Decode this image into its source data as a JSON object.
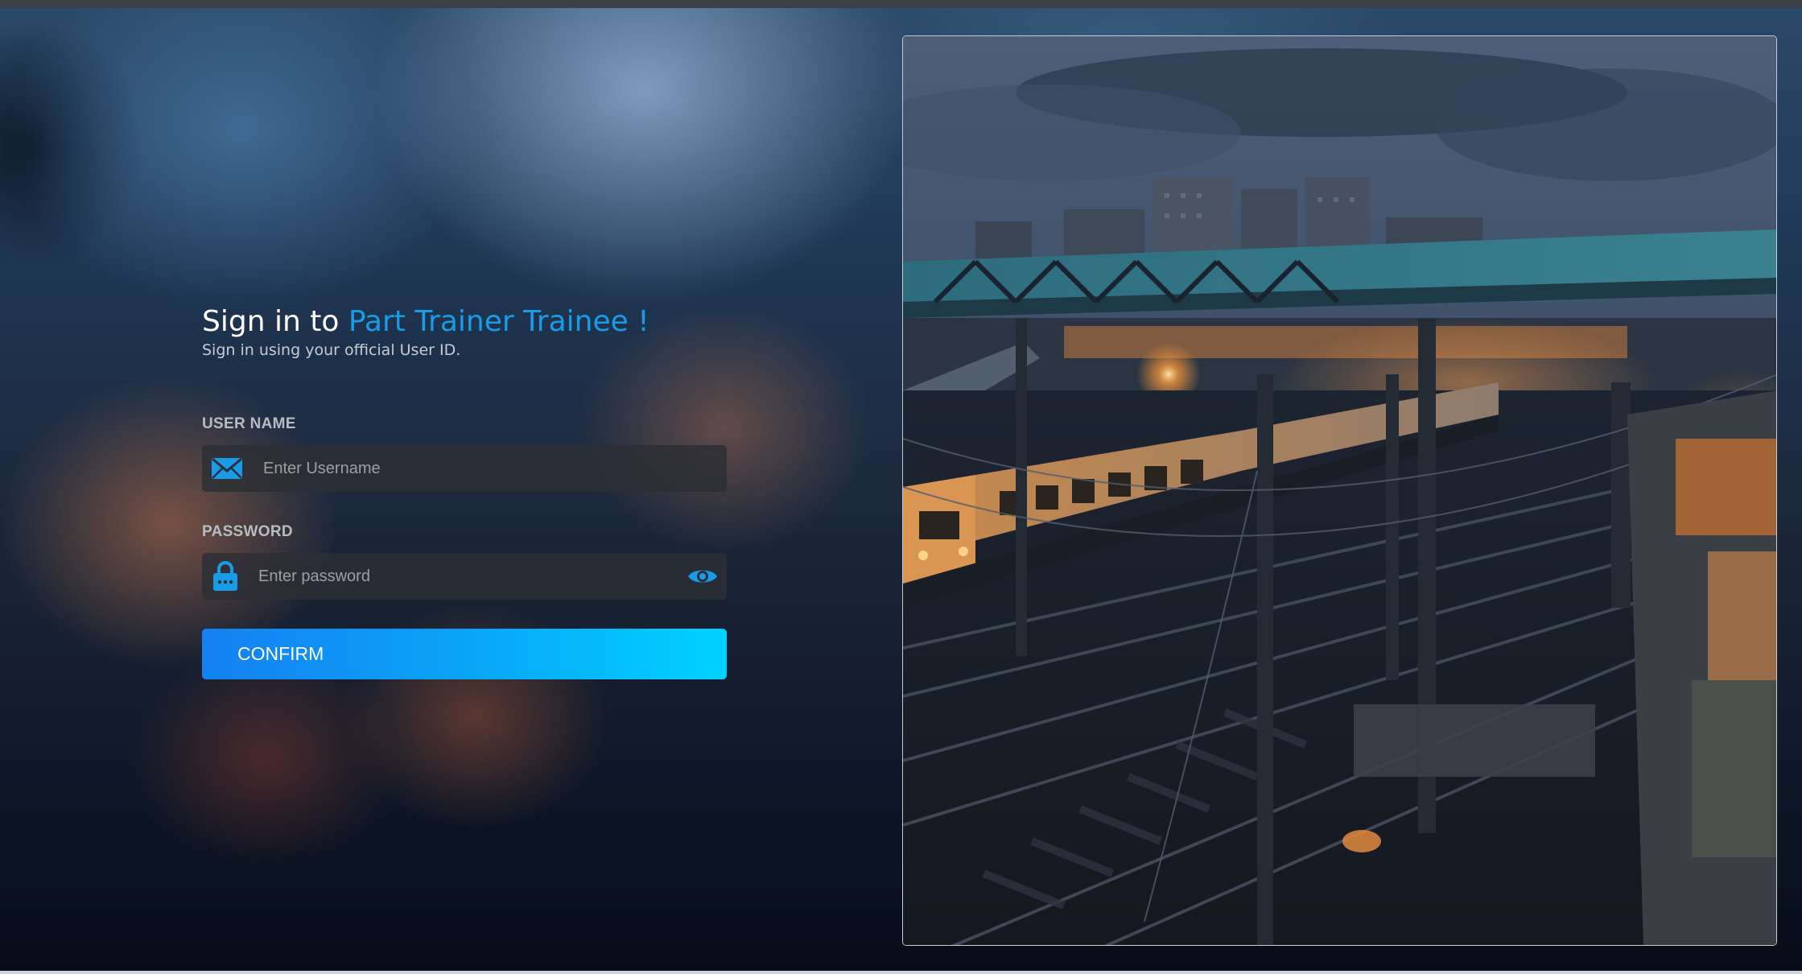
{
  "heading": {
    "prefix": "Sign in to ",
    "app_name": "Part Trainer Trainee !",
    "subtitle": "Sign in using your official User ID."
  },
  "username": {
    "label": "USER NAME",
    "placeholder": "Enter Username",
    "value": "",
    "icon": "envelope-icon"
  },
  "password": {
    "label": "PASSWORD",
    "placeholder": "Enter password",
    "value": "",
    "icon": "lock-icon",
    "toggle_icon": "eye-icon"
  },
  "confirm_button": {
    "label": "CONFIRM"
  },
  "colors": {
    "accent": "#1a9be8",
    "button_start": "#1580f2",
    "button_end": "#00d2ff",
    "field_bg": "#2c2e34"
  },
  "photo": {
    "subject": "railway-station-at-dusk-image"
  }
}
